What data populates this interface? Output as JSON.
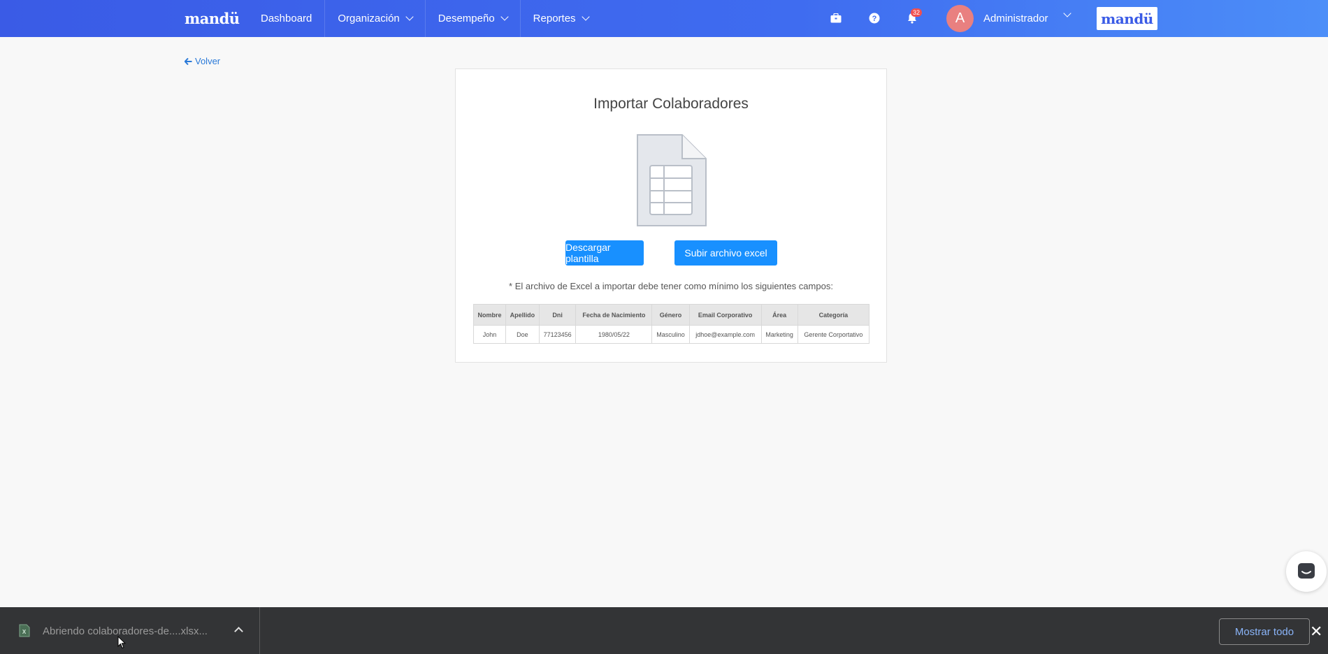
{
  "navbar": {
    "brand": "mandü",
    "links": [
      {
        "label": "Dashboard",
        "dropdown": false
      },
      {
        "label": "Organización",
        "dropdown": true
      },
      {
        "label": "Desempeño",
        "dropdown": true
      },
      {
        "label": "Reportes",
        "dropdown": true
      }
    ],
    "icons": [
      "briefcase-icon",
      "help-icon",
      "bell-icon"
    ],
    "notification_count": "32",
    "avatar_initial": "A",
    "user_name": "Administrador",
    "brand_badge": "mandü",
    "accent_color": "#3a5be6"
  },
  "back_link": "Volver",
  "card": {
    "title": "Importar Colaboradores",
    "download_button": "Descargar plantilla",
    "upload_button": "Subir archivo excel",
    "note": "* El archivo de Excel a importar debe tener como mínimo los siguientes campos:",
    "table": {
      "headers": [
        "Nombre",
        "Apellido",
        "Dni",
        "Fecha de Nacimiento",
        "Género",
        "Email Corporativo",
        "Área",
        "Categoría"
      ],
      "row": [
        "John",
        "Doe",
        "77123456",
        "1980/05/22",
        "Masculino",
        "jdhoe@example.com",
        "Marketing",
        "Gerente Corportativo"
      ]
    },
    "button_color": "#1890ff"
  },
  "download_bar": {
    "file_label": "Abriendo colaboradores-de....xlsx...",
    "show_all": "Mostrar todo",
    "close": "✕"
  }
}
